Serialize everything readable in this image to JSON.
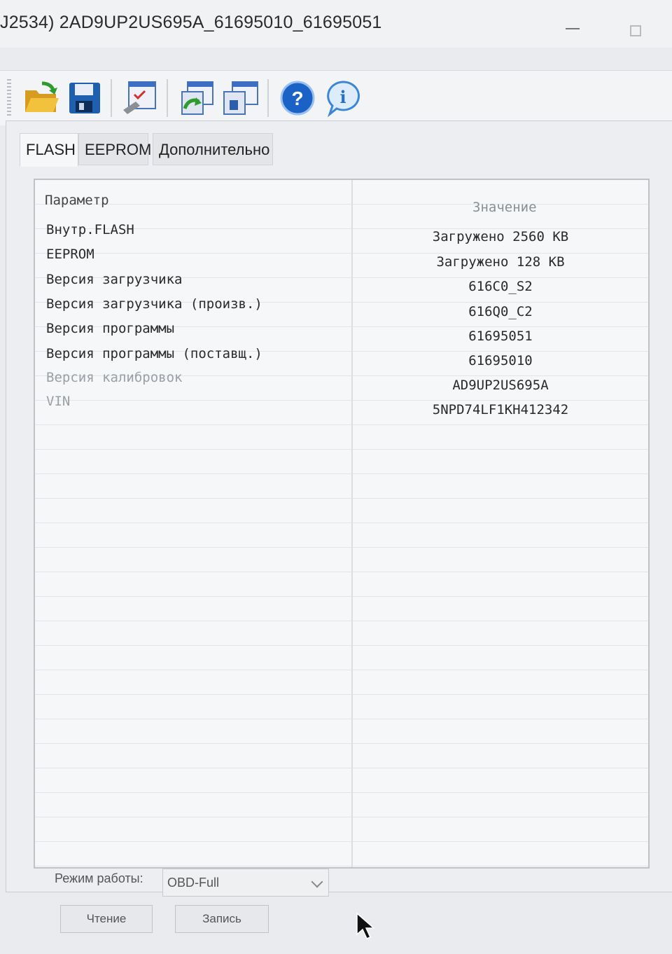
{
  "window": {
    "title": "J2534) 2AD9UP2US695A_61695010_61695051"
  },
  "toolbar": {
    "buttons": [
      {
        "icon": "open-folder-icon"
      },
      {
        "icon": "save-disk-icon"
      },
      {
        "icon": "settings-checklist-icon"
      },
      {
        "icon": "read-ecu-icon"
      },
      {
        "icon": "write-ecu-icon"
      },
      {
        "icon": "help-icon"
      },
      {
        "icon": "info-icon"
      }
    ]
  },
  "tabs": [
    {
      "label": "FLASH",
      "active": true
    },
    {
      "label": "EEPROM",
      "active": false
    },
    {
      "label": "Дополнительно",
      "active": false
    }
  ],
  "table": {
    "headers": {
      "param": "Параметр",
      "value": "Значение"
    },
    "rows": [
      {
        "name": "Внутр.FLASH",
        "value": "Загружено 2560 КВ"
      },
      {
        "name": "EEPROM",
        "value": "Загружено 128 КВ"
      },
      {
        "name": "Версия загрузчика",
        "value": "616C0_S2"
      },
      {
        "name": "Версия загрузчика (произв.)",
        "value": "616Q0_C2"
      },
      {
        "name": "Версия программы",
        "value": "61695051"
      },
      {
        "name": "Версия программы (поставщ.)",
        "value": "61695010"
      },
      {
        "name": "Версия калибровок",
        "value": "AD9UP2US695A"
      },
      {
        "name": "VIN",
        "value": "5NPD74LF1KH412342"
      }
    ]
  },
  "footer": {
    "mode_label": "Режим работы:",
    "mode_value": "OBD-Full",
    "read_button": "Чтение",
    "write_button": "Запись"
  }
}
